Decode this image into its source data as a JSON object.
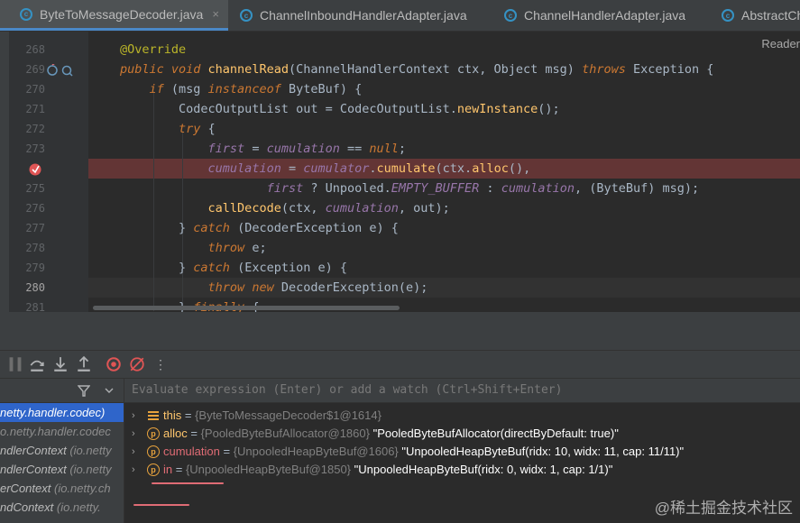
{
  "tabs": [
    {
      "label": "ByteToMessageDecoder.java",
      "active": true,
      "close": "×"
    },
    {
      "label": "ChannelInboundHandlerAdapter.java",
      "active": false
    },
    {
      "label": "ChannelHandlerAdapter.java",
      "active": false
    },
    {
      "label": "AbstractCh",
      "active": false
    }
  ],
  "editor": {
    "reader_mode": "Reader",
    "line_numbers": [
      "268",
      "269",
      "270",
      "271",
      "272",
      "273",
      "",
      "275",
      "276",
      "277",
      "278",
      "279",
      "280",
      "281"
    ],
    "lines": [
      {
        "parts": [
          {
            "t": "@Override",
            "c": "ann"
          }
        ]
      },
      {
        "parts": [
          {
            "t": "public void ",
            "c": "kw"
          },
          {
            "t": "channelRead",
            "c": "mth"
          },
          {
            "t": "(ChannelHandlerContext ctx, Object msg) "
          },
          {
            "t": "throws ",
            "c": "kw"
          },
          {
            "t": "Exception {"
          }
        ]
      },
      {
        "parts": [
          {
            "t": "    "
          },
          {
            "t": "if ",
            "c": "kw"
          },
          {
            "t": "(msg "
          },
          {
            "t": "instanceof ",
            "c": "kw"
          },
          {
            "t": "ByteBuf) {"
          }
        ]
      },
      {
        "parts": [
          {
            "t": "        CodecOutputList out = CodecOutputList."
          },
          {
            "t": "newInstance",
            "c": "mth"
          },
          {
            "t": "();"
          }
        ]
      },
      {
        "parts": [
          {
            "t": "        "
          },
          {
            "t": "try ",
            "c": "kw"
          },
          {
            "t": "{"
          }
        ]
      },
      {
        "parts": [
          {
            "t": "            "
          },
          {
            "t": "first",
            "c": "fld"
          },
          {
            "t": " = "
          },
          {
            "t": "cumulation",
            "c": "fld"
          },
          {
            "t": " == "
          },
          {
            "t": "null",
            "c": "kw"
          },
          {
            "t": ";"
          }
        ]
      },
      {
        "parts": [
          {
            "t": "            "
          },
          {
            "t": "cumulation",
            "c": "fld"
          },
          {
            "t": " = "
          },
          {
            "t": "cumulator",
            "c": "fld"
          },
          {
            "t": "."
          },
          {
            "t": "cumulate",
            "c": "mth"
          },
          {
            "t": "(ctx."
          },
          {
            "t": "alloc",
            "c": "mth"
          },
          {
            "t": "(),"
          }
        ]
      },
      {
        "parts": [
          {
            "t": "                    "
          },
          {
            "t": "first",
            "c": "fld"
          },
          {
            "t": " ? Unpooled."
          },
          {
            "t": "EMPTY_BUFFER",
            "c": "cst"
          },
          {
            "t": " : "
          },
          {
            "t": "cumulation",
            "c": "fld"
          },
          {
            "t": ", (ByteBuf) msg);"
          }
        ]
      },
      {
        "parts": [
          {
            "t": "            "
          },
          {
            "t": "callDecode",
            "c": "mth"
          },
          {
            "t": "(ctx, "
          },
          {
            "t": "cumulation",
            "c": "fld"
          },
          {
            "t": ", out);"
          }
        ]
      },
      {
        "parts": [
          {
            "t": "        } "
          },
          {
            "t": "catch ",
            "c": "kw"
          },
          {
            "t": "(DecoderException e) {"
          }
        ]
      },
      {
        "parts": [
          {
            "t": "            "
          },
          {
            "t": "throw ",
            "c": "kw"
          },
          {
            "t": "e;"
          }
        ]
      },
      {
        "parts": [
          {
            "t": "        } "
          },
          {
            "t": "catch ",
            "c": "kw"
          },
          {
            "t": "(Exception e) {"
          }
        ]
      },
      {
        "parts": [
          {
            "t": "            "
          },
          {
            "t": "throw new ",
            "c": "kw"
          },
          {
            "t": "DecoderException(e);"
          }
        ]
      },
      {
        "parts": [
          {
            "t": "        } "
          },
          {
            "t": "finally ",
            "c": "kw"
          },
          {
            "t": "{"
          }
        ]
      }
    ]
  },
  "debug": {
    "toolbar_more": "⋮",
    "eval_placeholder": "Evaluate expression (Enter) or add a watch (Ctrl+Shift+Enter)",
    "frames": [
      {
        "plain": "netty.handler.codec)",
        "italic": "",
        "selected": true
      },
      {
        "plain": "",
        "italic": "o.netty.handler.codec",
        "selected": false
      },
      {
        "plain": "ndlerContext ",
        "italic": "(io.netty",
        "selected": false
      },
      {
        "plain": "ndlerContext ",
        "italic": "(io.netty",
        "selected": false
      },
      {
        "plain": "erContext ",
        "italic": "(io.netty.ch",
        "selected": false
      },
      {
        "plain": "ndContext ",
        "italic": "(io.netty.",
        "selected": false
      }
    ],
    "variables": [
      {
        "icon": "lines",
        "name": "this",
        "eq": " = ",
        "type": "{ByteToMessageDecoder$1@1614}",
        "value": ""
      },
      {
        "icon": "p",
        "name": "alloc",
        "eq": " = ",
        "type": "{PooledByteBufAllocator@1860}",
        "value": " \"PooledByteBufAllocator(directByDefault: true)\""
      },
      {
        "icon": "p",
        "name": "cumulation",
        "eq": " = ",
        "type": "{UnpooledHeapByteBuf@1606}",
        "value": " \"UnpooledHeapByteBuf(ridx: 10, widx: 11, cap: 11/11)\""
      },
      {
        "icon": "p",
        "name": "in",
        "eq": " = ",
        "type": "{UnpooledHeapByteBuf@1850}",
        "value": " \"UnpooledHeapByteBuf(ridx: 0, widx: 1, cap: 1/1)\""
      }
    ]
  },
  "watermark": "@稀土掘金技术社区"
}
